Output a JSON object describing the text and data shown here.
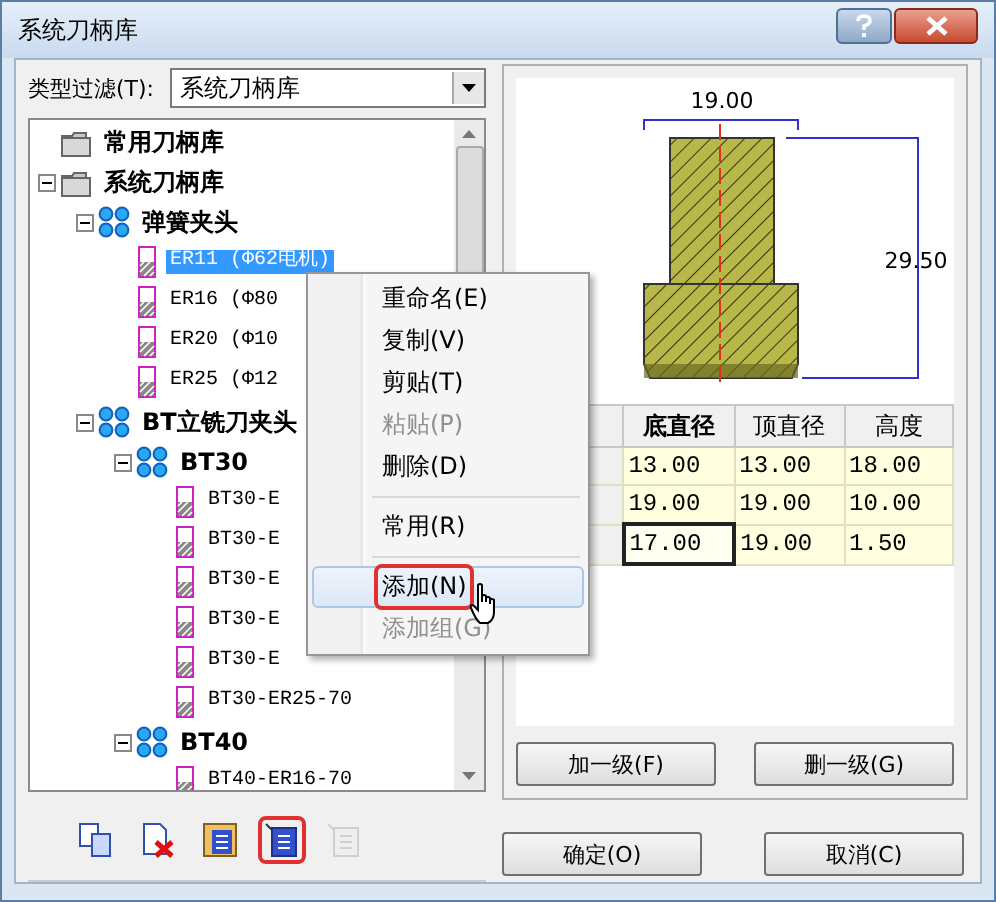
{
  "window": {
    "title": "系统刀柄库"
  },
  "filter": {
    "label": "类型过滤(T):",
    "value": "系统刀柄库"
  },
  "tree": [
    {
      "label": "常用刀柄库",
      "kind": "folder",
      "selected": false
    },
    {
      "label": "系统刀柄库",
      "kind": "folder",
      "expanded": true,
      "selected": false,
      "children": [
        {
          "label": "弹簧夹头",
          "kind": "group",
          "expanded": true,
          "selected": false,
          "children": [
            {
              "label": "ER11 (Φ62电机)",
              "kind": "item",
              "selected": true
            },
            {
              "label": "ER16 (Φ80",
              "kind": "item",
              "selected": false
            },
            {
              "label": "ER20 (Φ10",
              "kind": "item",
              "selected": false
            },
            {
              "label": "ER25 (Φ12",
              "kind": "item",
              "selected": false
            }
          ]
        },
        {
          "label": "BT立铣刀夹头",
          "kind": "group",
          "expanded": true,
          "selected": false,
          "children": [
            {
              "label": "BT30",
              "kind": "group",
              "expanded": true,
              "selected": false,
              "children": [
                {
                  "label": "BT30-E",
                  "kind": "item",
                  "selected": false
                },
                {
                  "label": "BT30-E",
                  "kind": "item",
                  "selected": false
                },
                {
                  "label": "BT30-E",
                  "kind": "item",
                  "selected": false
                },
                {
                  "label": "BT30-E",
                  "kind": "item",
                  "selected": false
                },
                {
                  "label": "BT30-E",
                  "kind": "item",
                  "selected": false
                },
                {
                  "label": "BT30-ER25-70",
                  "kind": "item",
                  "selected": false
                }
              ]
            },
            {
              "label": "BT40",
              "kind": "group",
              "expanded": true,
              "selected": false,
              "children": [
                {
                  "label": "BT40-ER16-70",
                  "kind": "item",
                  "selected": false
                }
              ]
            }
          ]
        }
      ]
    }
  ],
  "toolbar": [
    {
      "kind": "copy",
      "disabled": false,
      "highlighted": false
    },
    {
      "kind": "delete",
      "disabled": false,
      "highlighted": false
    },
    {
      "kind": "list",
      "disabled": false,
      "highlighted": false
    },
    {
      "kind": "new",
      "disabled": false,
      "highlighted": true
    },
    {
      "kind": "new-sub",
      "disabled": true,
      "highlighted": false
    }
  ],
  "drawing": {
    "width_label": "19.00",
    "height_label": "29.50"
  },
  "table": {
    "columns": [
      {
        "label": "底直径",
        "selected": true
      },
      {
        "label": "顶直径",
        "selected": false
      },
      {
        "label": "高度",
        "selected": false
      }
    ],
    "rows": [
      {
        "cells": [
          {
            "text": "13.00",
            "focused": false
          },
          {
            "text": "13.00",
            "focused": false
          },
          {
            "text": "18.00",
            "focused": false
          }
        ]
      },
      {
        "cells": [
          {
            "text": "19.00",
            "focused": false
          },
          {
            "text": "19.00",
            "focused": false
          },
          {
            "text": "10.00",
            "focused": false
          }
        ]
      },
      {
        "cells": [
          {
            "text": "17.00",
            "focused": true
          },
          {
            "text": "19.00",
            "focused": false
          },
          {
            "text": "1.50",
            "focused": false
          }
        ]
      }
    ]
  },
  "panel_buttons": [
    "加一级(F)",
    "删一级(G)"
  ],
  "dialog_buttons": [
    "确定(O)",
    "取消(C)"
  ],
  "context_menu": [
    {
      "kind": "item",
      "label": "重命名(E)",
      "disabled": false,
      "hovered": false,
      "highlighted": false
    },
    {
      "kind": "item",
      "label": "复制(V)",
      "disabled": false,
      "hovered": false,
      "highlighted": false
    },
    {
      "kind": "item",
      "label": "剪贴(T)",
      "disabled": false,
      "hovered": false,
      "highlighted": false
    },
    {
      "kind": "item",
      "label": "粘贴(P)",
      "disabled": true,
      "hovered": false,
      "highlighted": false
    },
    {
      "kind": "item",
      "label": "删除(D)",
      "disabled": false,
      "hovered": false,
      "highlighted": false
    },
    {
      "kind": "separator"
    },
    {
      "kind": "item",
      "label": "常用(R)",
      "disabled": false,
      "hovered": false,
      "highlighted": false
    },
    {
      "kind": "separator"
    },
    {
      "kind": "item",
      "label": "添加(N)",
      "disabled": false,
      "hovered": true,
      "highlighted": true
    },
    {
      "kind": "item",
      "label": "添加组(G)",
      "disabled": true,
      "hovered": false,
      "highlighted": false
    }
  ]
}
